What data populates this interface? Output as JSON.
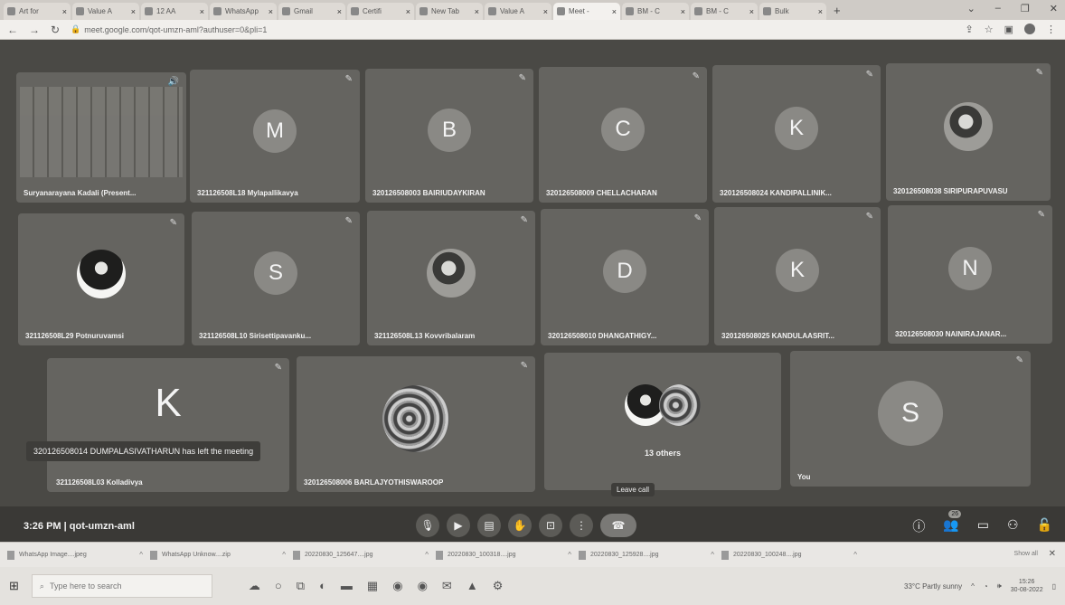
{
  "browser": {
    "tabs": [
      {
        "label": "Art for"
      },
      {
        "label": "Value A"
      },
      {
        "label": "12 AA"
      },
      {
        "label": "WhatsApp"
      },
      {
        "label": "Gmail"
      },
      {
        "label": "Certifi"
      },
      {
        "label": "New Tab"
      },
      {
        "label": "Value A"
      },
      {
        "label": "Meet -"
      },
      {
        "label": "BM - C"
      },
      {
        "label": "BM - C"
      },
      {
        "label": "Bulk"
      }
    ],
    "new_tab": "+",
    "url": "meet.google.com/qot-umzn-aml?authuser=0&pli=1"
  },
  "meet": {
    "tiles": [
      {
        "name": "Suryanarayana Kadali (Present..."
      },
      {
        "name": "321126508L18 Mylapallikavya",
        "initial": "M"
      },
      {
        "name": "320126508003 BAIRIUDAYKIRAN",
        "initial": "B"
      },
      {
        "name": "320126508009 CHELLACHARAN",
        "initial": "C"
      },
      {
        "name": "320126508024 KANDIPALLINIK...",
        "initial": "K"
      },
      {
        "name": "320126508038 SIRIPURAPUVASU"
      },
      {
        "name": "321126508L29 Potnuruvamsi"
      },
      {
        "name": "321126508L10 Sirisettipavanku...",
        "initial": "S"
      },
      {
        "name": "321126508L13 Kovvribalaram"
      },
      {
        "name": "320126508010 DHANGATHIGY...",
        "initial": "D"
      },
      {
        "name": "320126508025 KANDULAASRIT...",
        "initial": "K"
      },
      {
        "name": "320126508030 NAINIRAJANAR...",
        "initial": "N"
      },
      {
        "name": "321126508L03 Kolladivya",
        "initial": "K"
      },
      {
        "name": "320126508006 BARLAJYOTHISWAROOP"
      },
      {
        "name": "13 others"
      },
      {
        "name": "You",
        "initial": "S"
      }
    ],
    "toast": "320126508014 DUMPALASIVATHARUN has left the meeting",
    "leave_tooltip": "Leave call",
    "time": "3:26 PM",
    "separator": "|",
    "meeting_code": "qot-umzn-aml",
    "participants_count": "26"
  },
  "downloads": {
    "items": [
      {
        "name": "WhatsApp Image....jpeg"
      },
      {
        "name": "WhatsApp Unknow....zip"
      },
      {
        "name": "20220830_125647....jpg"
      },
      {
        "name": "20220830_100318....jpg"
      },
      {
        "name": "20220830_125928....jpg"
      },
      {
        "name": "20220830_100248....jpg"
      }
    ],
    "show_all": "Show all"
  },
  "taskbar": {
    "search_placeholder": "Type here to search",
    "weather": "33°C  Partly sunny",
    "time": "15:26",
    "date": "30-08-2022"
  }
}
